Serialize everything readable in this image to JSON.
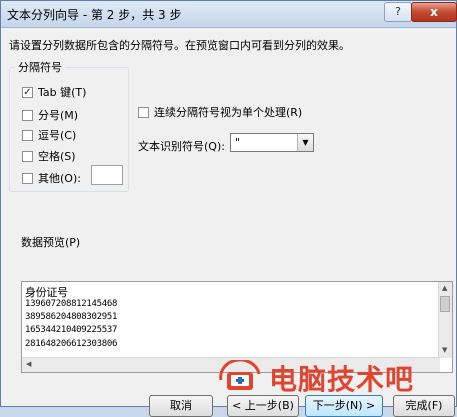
{
  "window": {
    "title": "文本分列向导 - 第 2 步，共 3 步",
    "help_label": "?",
    "close_label": "x"
  },
  "description": "请设置分列数据所包含的分隔符号。在预览窗口内可看到分列的效果。",
  "delimiters": {
    "group_title": "分隔符号",
    "items": [
      {
        "label": "Tab 键(T)",
        "checked": true,
        "check_glyph": "✓"
      },
      {
        "label": "分号(M)",
        "checked": false,
        "check_glyph": ""
      },
      {
        "label": "逗号(C)",
        "checked": false,
        "check_glyph": ""
      },
      {
        "label": "空格(S)",
        "checked": false,
        "check_glyph": ""
      },
      {
        "label": "其他(O):",
        "checked": false,
        "check_glyph": ""
      }
    ],
    "other_value": ""
  },
  "consecutive": {
    "label": "连续分隔符号视为单个处理(R)",
    "checked": false
  },
  "text_qualifier": {
    "label": "文本识别符号(Q):",
    "value": "\"",
    "arrow": "▼"
  },
  "preview": {
    "label": "数据预览(P)",
    "lines": [
      "身份证号",
      "139607208812145468",
      "389586204808302951",
      "165344210409225537",
      "281648206612303806"
    ],
    "scroll_up": "▲",
    "scroll_down": "▼",
    "scroll_left": "◀"
  },
  "buttons": {
    "cancel": "取消",
    "back": "< 上一步(B)",
    "next": "下一步(N) >",
    "finish": "完成(F)"
  },
  "watermark": {
    "text": "电脑技术吧"
  },
  "colors": {
    "accent": "#3c7fb1",
    "watermark": "#e0452f"
  }
}
